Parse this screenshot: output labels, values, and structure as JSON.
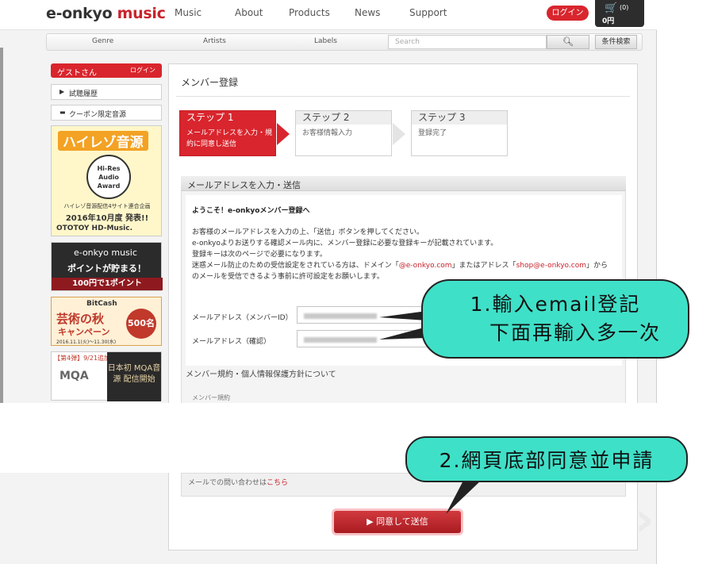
{
  "header": {
    "logo_prefix": "e-onkyo",
    "logo_suffix": "music",
    "nav": [
      "Music",
      "About",
      "Products",
      "News",
      "Support"
    ],
    "login_label": "ログイン",
    "cart_count": "(0)",
    "cart_total": "0円"
  },
  "subnav": {
    "items": [
      "Genre",
      "Artists",
      "Labels"
    ],
    "search_placeholder": "Search",
    "advanced_label": "条件検索"
  },
  "sidebar": {
    "guest_name": "ゲストさん",
    "guest_login": "ログイン",
    "links": [
      "試聴履歴",
      "クーポン限定音源"
    ],
    "banner1": {
      "title": "ハイレゾ音源",
      "award": "Hi-Res Audio Award",
      "line1": "ハイレゾ音源配信4サイト連合企画",
      "line2": "2016年10月度 発表!!",
      "brands": "OTOTOY HD-Music."
    },
    "banner2": {
      "line1": "e-onkyo music",
      "line2": "ポイントが貯まる！",
      "line3": "100円で1ポイント"
    },
    "banner3": {
      "brand": "BitCash",
      "line1": "芸術の秋",
      "line2": "キャンペーン",
      "dates": "2016.11.1(火)～11.30(水)",
      "circle": "500名"
    },
    "banner4": {
      "tag": "【第4弾】9/21追加",
      "logo": "MQA",
      "dark": "日本初 MQA音源 配信開始"
    }
  },
  "main": {
    "title": "メンバー登録",
    "steps": [
      {
        "label": "ステップ 1",
        "desc": "メールアドレスを入力・規約に同意し送信"
      },
      {
        "label": "ステップ 2",
        "desc": "お客様情報入力"
      },
      {
        "label": "ステップ 3",
        "desc": "登録完了"
      }
    ],
    "section_title": "メールアドレスを入力・送信",
    "welcome": "ようこそ！e-onkyoメンバー登録へ",
    "paragraph": [
      "お客様のメールアドレスを入力の上、「送信」ボタンを押してください。",
      "e-onkyoよりお送りする確認メール内に、メンバー登録に必要な登録キーが記載されています。",
      "登録キーは次のページで必要になります。"
    ],
    "para4_before": "迷惑メール防止のための受信設定をされている方は、ドメイン「",
    "para4_domain": "@e-onkyo.com",
    "para4_mid": "」またはアドレス「",
    "para4_addr": "shop@e-onkyo.com",
    "para4_after": "」から",
    "para5": "のメールを受信できるよう事前に許可設定をお願いします。",
    "email_label": "メールアドレス（メンバーID）",
    "confirm_label": "メールアドレス（確認）",
    "terms_title": "メンバー規約・個人情報保護方針について",
    "terms_sub": "メンバー規約",
    "contact_text": "メールでの問い合わせは",
    "contact_link": "こちら",
    "submit_label": "▶ 同意して送信"
  },
  "callouts": {
    "one_line1": "1.輸入email登記",
    "one_line2": "下面再輸入多一次",
    "two": "2.網頁底部同意並申請"
  },
  "colors": {
    "brand_red": "#d9252d",
    "callout": "#3fe0c8"
  }
}
